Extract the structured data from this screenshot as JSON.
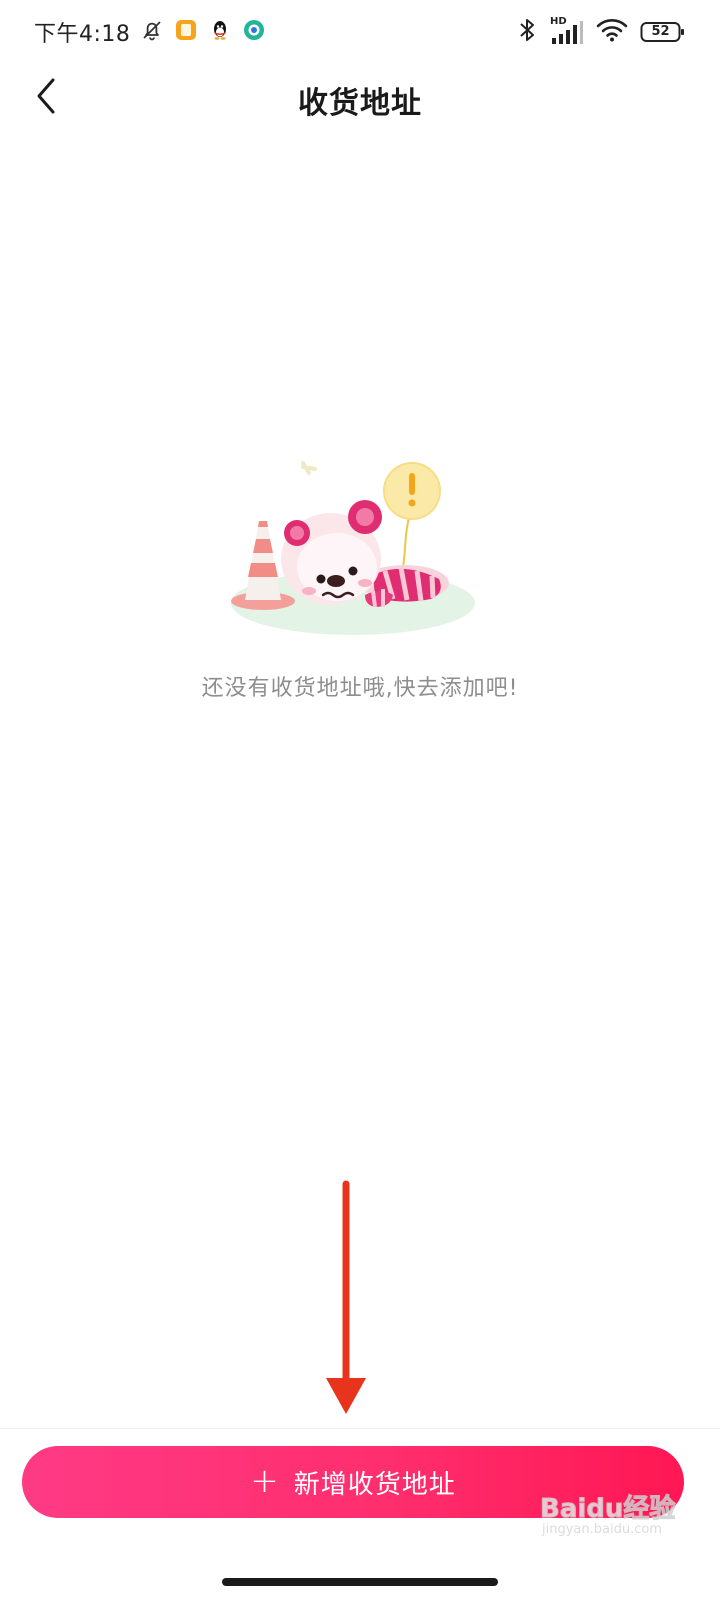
{
  "status_bar": {
    "time": "下午4:18",
    "network_label": "HD",
    "battery": "52"
  },
  "nav": {
    "title": "收货地址"
  },
  "empty_state": {
    "message": "还没有收货地址哦,快去添加吧!"
  },
  "action": {
    "plus": "+",
    "add_label": "新增收货地址"
  },
  "watermark": {
    "brand": "Baidu经验",
    "url": "jingyan.baidu.com"
  },
  "colors": {
    "accent_start": "#ff3a85",
    "accent_end": "#ff1753",
    "annotation_arrow": "#e8341c",
    "empty_text": "#8e8e8e"
  },
  "icons": [
    "muted-bell-icon",
    "notes-app-icon",
    "qq-icon",
    "browser-icon",
    "bluetooth-icon",
    "cellular-signal-icon",
    "wifi-icon",
    "battery-icon",
    "back-chevron-icon"
  ]
}
